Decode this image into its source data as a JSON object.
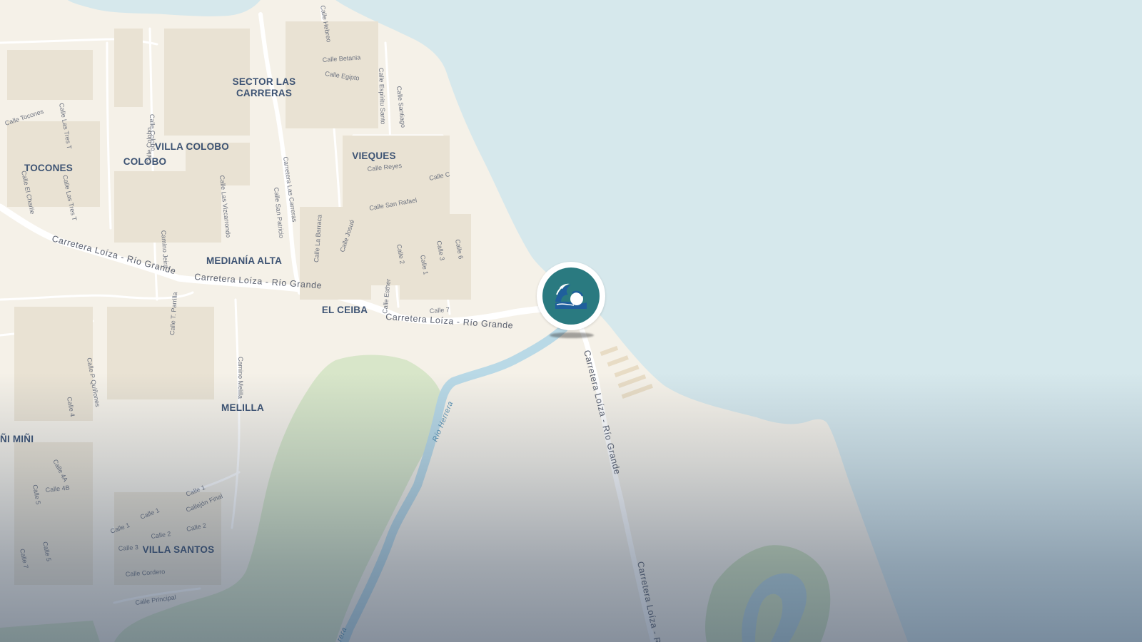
{
  "map": {
    "places": {
      "sector_las_carreras_line1": "SECTOR LAS",
      "sector_las_carreras_line2": "CARRERAS",
      "villa_colobo": "VILLA COLOBO",
      "colobo": "COLOBO",
      "tocones": "TOCONES",
      "vieques": "VIEQUES",
      "mediania_alta": "MEDIANÍA ALTA",
      "el_ceiba": "EL CEIBA",
      "melilla": "MELILLA",
      "mini_mini": "ÑI MIÑI",
      "villa_santos": "VILLA SANTOS"
    },
    "roads": {
      "carretera_1": "Carretera Loíza - Río Grande",
      "carretera_2": "Carretera Loíza - Río Grande",
      "carretera_3": "Carretera Loíza - Río Grande",
      "carretera_4": "Carretera Loíza - Río Grande",
      "carretera_5": "Carretera Loíza - R"
    },
    "streets": {
      "hebreo": "Calle Hebreo",
      "betania": "Calle Betania",
      "egipto": "Calle Egipto",
      "espiritu_santo": "Calle Espíritu Santo",
      "santiago": "Calle Santiago",
      "tocones": "Calle Tocones",
      "las_tres_t": "Calle Las Tres T",
      "las_tres_t_2": "Calle Las Tres T",
      "el_charlie": "Calle El Charlie",
      "colobo": "Calle Colobo",
      "colobo_2": "Calle Colobo",
      "las_vizcarrondo": "Calle Las Vizcarrondo",
      "carretera_las_carreras": "Carretera Las Carreras",
      "san_patricio": "Calle San Patricio",
      "reyes": "Calle Reyes",
      "calle_c": "Calle C",
      "san_rafael": "Calle San Rafael",
      "la_barraca": "Calle La Barraca",
      "josue": "Calle Josué",
      "calle_2": "Calle 2",
      "calle_1": "Calle 1",
      "calle_3": "Calle 3",
      "calle_6": "Calle 6",
      "esther": "Calle Esther",
      "calle_7": "Calle 7",
      "camino_jeira": "Camino Jeira",
      "t_parrilla": "Calle T. Parrilla",
      "camino_melilla": "Camino Melilla",
      "p_quinones": "Calle P Quiñones",
      "calle_4": "Calle 4",
      "calle_4a": "Calle 4A",
      "calle_4b": "Calle 4B",
      "calle_5": "Calle 5",
      "calle_5b": "Calle 5",
      "calle_7b": "Calle 7",
      "calle_1b": "Calle 1",
      "calle_1c": "Calle 1",
      "calle_1d": "Calle 1",
      "callejon_final": "Callejón Final",
      "calle_2b": "Calle 2",
      "calle_2c": "Calle 2",
      "calle_3b": "Calle 3",
      "cordero": "Calle Cordero",
      "principal": "Calle Principal"
    },
    "water": {
      "rio_herrera": "Río Herrera",
      "rio_herrera_2": "rera"
    }
  },
  "marker": {
    "icon": "ocean-wave-icon",
    "color": "#2a7a80"
  },
  "colors": {
    "land": "#f5f1e8",
    "water": "#d6e8ec",
    "park": "#dde8cf",
    "forest": "#c9dcb6",
    "road": "#ffffff",
    "river": "#b9d9e6"
  }
}
